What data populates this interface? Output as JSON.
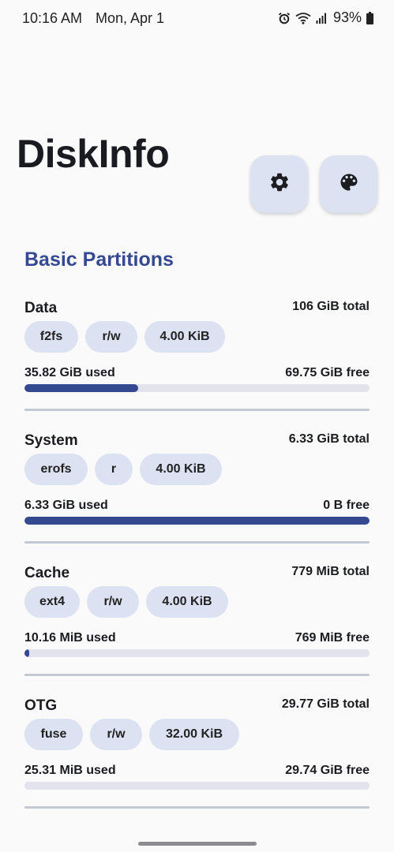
{
  "status": {
    "time": "10:16 AM",
    "date": "Mon, Apr 1",
    "battery_pct": "93%",
    "icons": [
      "alarm-icon",
      "wifi-icon",
      "signal-icon",
      "battery-icon"
    ]
  },
  "app": {
    "title": "DiskInfo",
    "settings_icon": "gear-icon",
    "theme_icon": "palette-icon"
  },
  "section": {
    "title": "Basic Partitions"
  },
  "partitions": [
    {
      "name": "Data",
      "total": "106 GiB total",
      "chips": [
        "f2fs",
        "r/w",
        "4.00 KiB"
      ],
      "used": "35.82 GiB used",
      "free": "69.75 GiB free",
      "usage_fraction": 0.33
    },
    {
      "name": "System",
      "total": "6.33 GiB total",
      "chips": [
        "erofs",
        "r",
        "4.00 KiB"
      ],
      "used": "6.33 GiB used",
      "free": "0 B free",
      "usage_fraction": 1.0
    },
    {
      "name": "Cache",
      "total": "779 MiB total",
      "chips": [
        "ext4",
        "r/w",
        "4.00 KiB"
      ],
      "used": "10.16 MiB used",
      "free": "769 MiB free",
      "usage_fraction": 0.013
    },
    {
      "name": "OTG",
      "total": "29.77 GiB total",
      "chips": [
        "fuse",
        "r/w",
        "32.00 KiB"
      ],
      "used": "25.31 MiB used",
      "free": "29.74 GiB free",
      "usage_fraction": 0.0008
    }
  ],
  "colors": {
    "accent": "#34498f",
    "chip_bg": "#dde2f3",
    "track": "#e2e3ec",
    "background": "#fafafb"
  }
}
